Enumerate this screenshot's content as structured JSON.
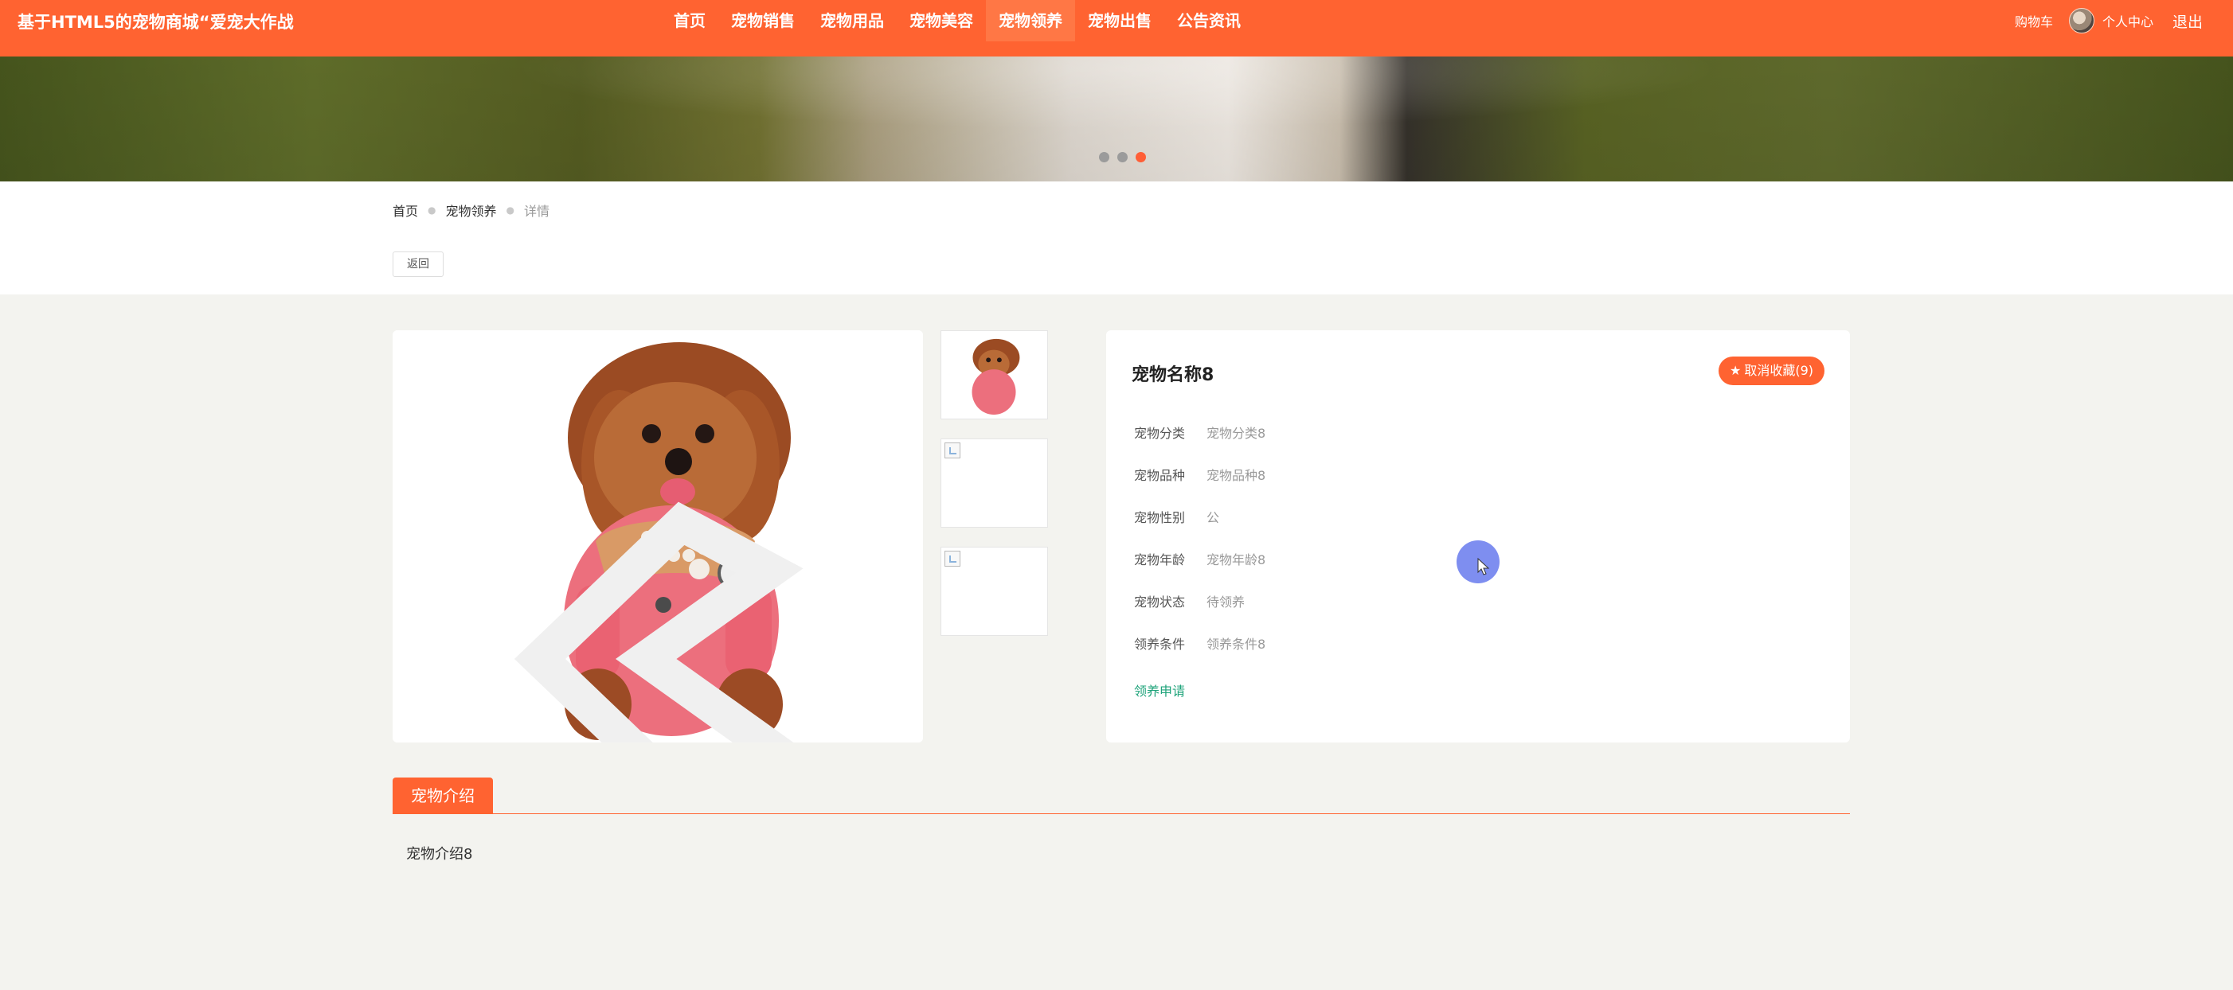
{
  "header": {
    "site_title": "基于HTML5的宠物商城“爱宠大作战",
    "nav": [
      {
        "label": "首页",
        "active": false
      },
      {
        "label": "宠物销售",
        "active": false
      },
      {
        "label": "宠物用品",
        "active": false
      },
      {
        "label": "宠物美容",
        "active": false
      },
      {
        "label": "宠物领养",
        "active": true
      },
      {
        "label": "宠物出售",
        "active": false
      },
      {
        "label": "公告资讯",
        "active": false
      }
    ],
    "cart_label": "购物车",
    "user_label": "个人中心",
    "logout_label": "退出"
  },
  "banner": {
    "dots": [
      false,
      false,
      true
    ]
  },
  "breadcrumb": {
    "items": [
      "首页",
      "宠物领养",
      "详情"
    ]
  },
  "back_button": "返回",
  "detail": {
    "name": "宠物名称8",
    "favorite_label": "取消收藏(9)",
    "fields": [
      {
        "label": "宠物分类",
        "value": "宠物分类8"
      },
      {
        "label": "宠物品种",
        "value": "宠物品种8"
      },
      {
        "label": "宠物性别",
        "value": "公"
      },
      {
        "label": "宠物年龄",
        "value": "宠物年龄8"
      },
      {
        "label": "宠物状态",
        "value": "待领养"
      },
      {
        "label": "领养条件",
        "value": "领养条件8"
      }
    ],
    "adopt_label": "领养申请"
  },
  "intro": {
    "tab_label": "宠物介绍",
    "text": "宠物介绍8"
  },
  "colors": {
    "brand": "#ff6331",
    "link_green": "#1ea37a",
    "page_bg": "#f3f3ef"
  }
}
